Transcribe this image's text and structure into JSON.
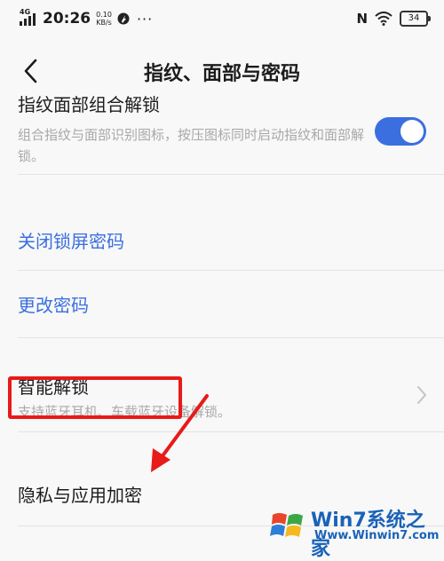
{
  "status_bar": {
    "network": "4G",
    "time": "20:26",
    "speed_value": "0.10",
    "speed_unit": "KB/s",
    "more": "···",
    "nfc": "N",
    "battery": "34"
  },
  "header": {
    "title": "指纹、面部与密码"
  },
  "settings": {
    "combined_unlock": {
      "title": "指纹面部组合解锁",
      "desc": "组合指纹与面部识别图标，按压图标同时启动指纹和面部解锁。",
      "enabled": true
    },
    "close_lock_password": "关闭锁屏密码",
    "change_password": "更改密码",
    "smart_unlock": {
      "title": "智能解锁",
      "desc": "支持蓝牙耳机、车载蓝牙设备解锁。"
    },
    "privacy_encryption": "隐私与应用加密"
  },
  "watermark": {
    "title": "Win7系统之家",
    "url": "Www.Winwin7.com"
  },
  "colors": {
    "accent": "#3b6fe0",
    "annotation": "#e81a1a"
  }
}
